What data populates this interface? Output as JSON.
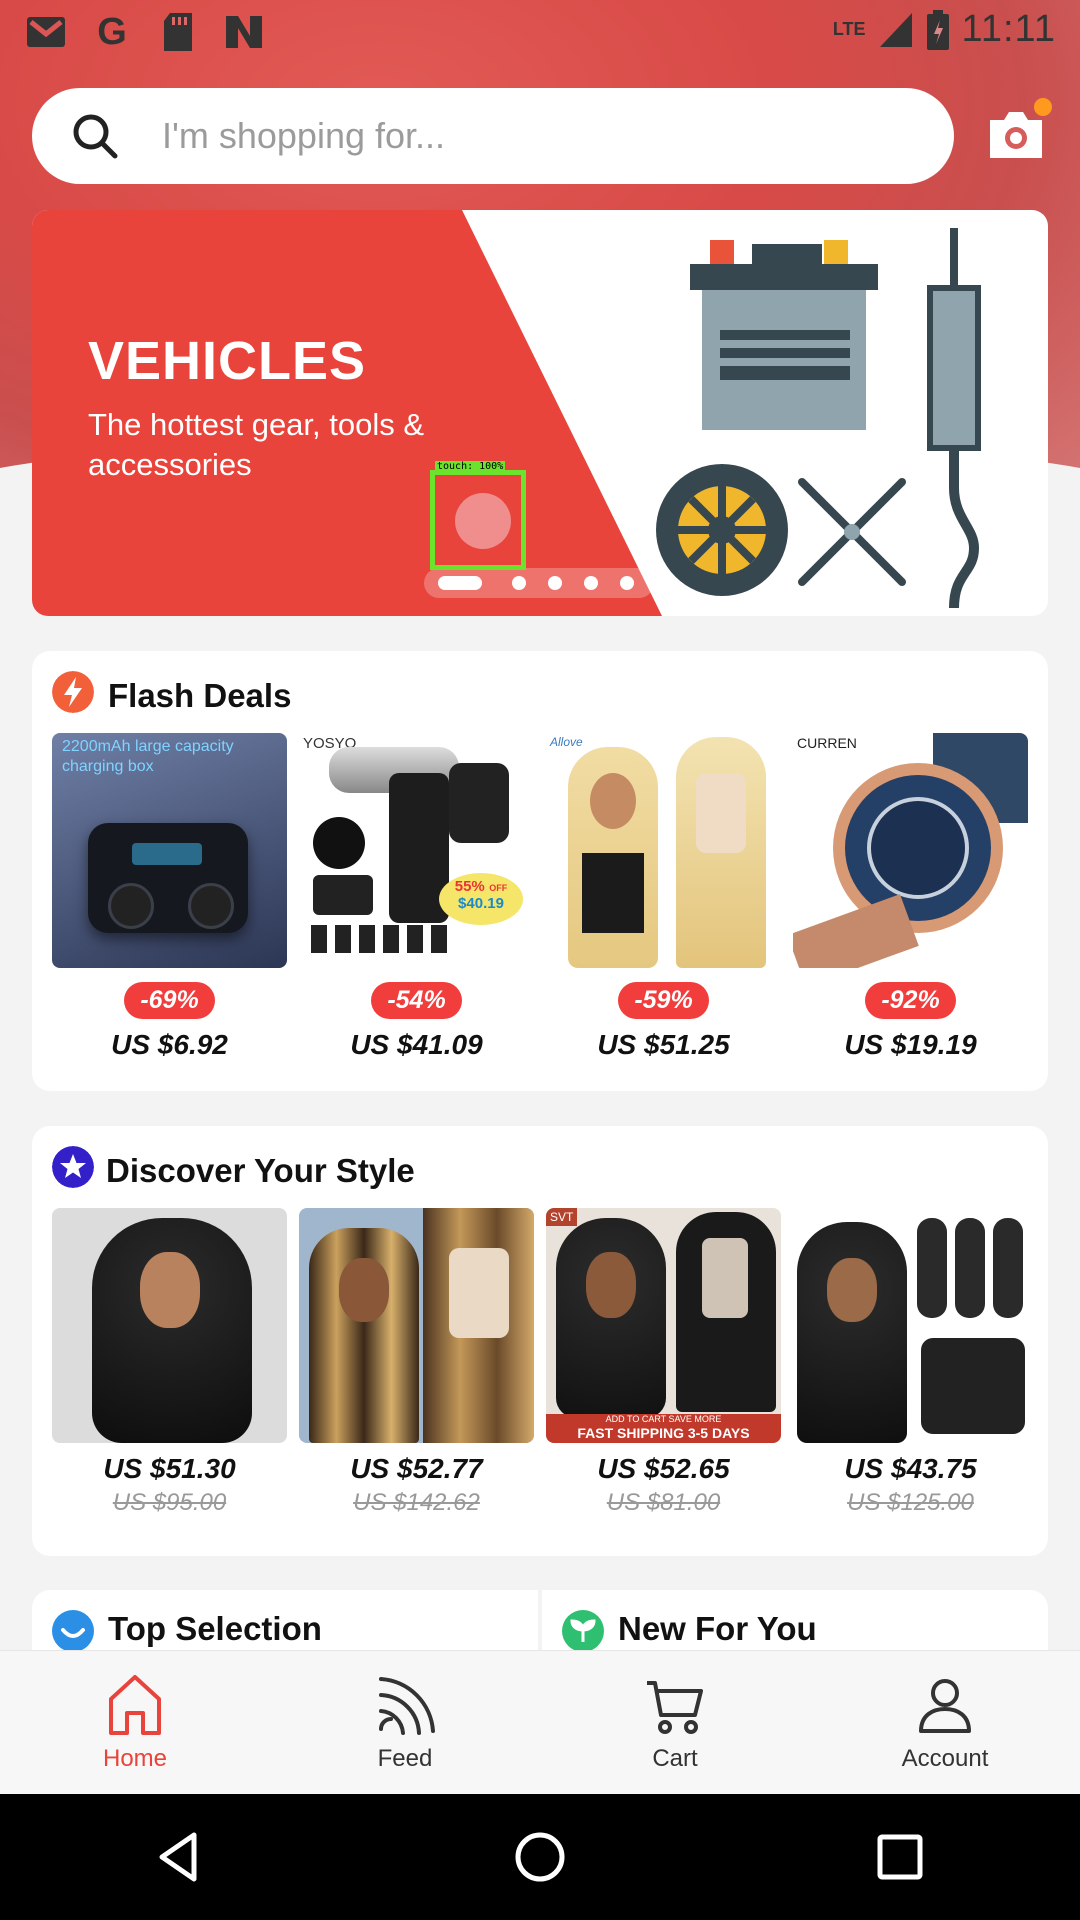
{
  "status_bar": {
    "time": "11:11",
    "network": "LTE",
    "left_icons": [
      "gmail-icon",
      "google-icon",
      "sd-card-icon",
      "news-icon"
    ]
  },
  "search": {
    "placeholder": "I'm shopping for..."
  },
  "banner": {
    "title": "VEHICLES",
    "subtitle": "The hottest gear, tools & accessories",
    "slide_count": 6,
    "active_slide": 1,
    "touch_label": "touch: 100%"
  },
  "flash_deals": {
    "title": "Flash Deals",
    "items": [
      {
        "discount": "-69%",
        "price": "US $6.92",
        "image": "earbuds-case",
        "caption": "2200mAh large capacity charging box"
      },
      {
        "discount": "-54%",
        "price": "US $41.09",
        "image": "massage-gun",
        "brand": "YOSYO",
        "badge_pct": "55%",
        "badge_off": "OFF",
        "badge_price": "$40.19"
      },
      {
        "discount": "-59%",
        "price": "US $51.25",
        "image": "blonde-wig",
        "brand": "Allove"
      },
      {
        "discount": "-92%",
        "price": "US $19.19",
        "image": "wrist-watch",
        "brand": "CURREN"
      }
    ]
  },
  "discover": {
    "title": "Discover Your Style",
    "items": [
      {
        "price": "US $51.30",
        "old_price": "US $95.00",
        "image": "curly-wig"
      },
      {
        "price": "US $52.77",
        "old_price": "US $142.62",
        "image": "highlight-wig"
      },
      {
        "price": "US $52.65",
        "old_price": "US $81.00",
        "image": "kinky-curly-wig",
        "brand": "SVT",
        "ribbon_top": "ADD TO CART SAVE MORE",
        "ribbon_main": "FAST SHIPPING 3-5 DAYS"
      },
      {
        "price": "US $43.75",
        "old_price": "US $125.00",
        "image": "body-wave-bundle"
      }
    ]
  },
  "sections": {
    "top_selection": "Top Selection",
    "new_for_you": "New For You"
  },
  "bottom_nav": {
    "home": "Home",
    "feed": "Feed",
    "cart": "Cart",
    "account": "Account"
  },
  "colors": {
    "accent": "#e8443c",
    "discount_bg": "#f23d3d",
    "banner_red": "#e8443c"
  }
}
